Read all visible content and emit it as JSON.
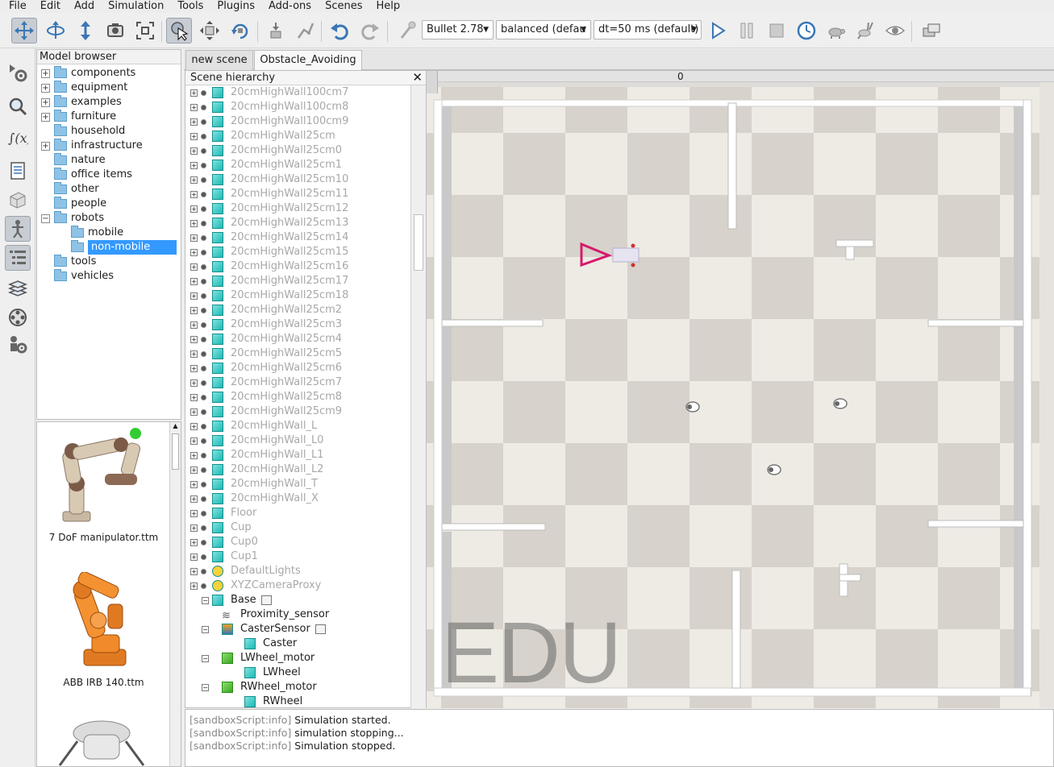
{
  "menu": [
    "File",
    "Edit",
    "Add",
    "Simulation",
    "Tools",
    "Plugins",
    "Add-ons",
    "Scenes",
    "Help"
  ],
  "toolbar": {
    "engine": "Bullet 2.78",
    "mode": "balanced (defau",
    "dt": "dt=50 ms (default)",
    "icons": [
      "camera-pan-icon",
      "camera-rotate-icon",
      "camera-shift-icon",
      "camera-angle-icon",
      "fit-to-view-icon",
      "object-select-icon",
      "object-shift-icon",
      "object-rotate-icon",
      "assemble-icon",
      "transfer-dna-icon",
      "undo-icon",
      "redo-icon",
      "dynamics-toggle-icon",
      "play-icon",
      "pause-icon",
      "stop-icon",
      "realtime-icon",
      "slower-icon",
      "faster-icon",
      "visualization-icon",
      "scene-layers-icon"
    ]
  },
  "model_browser": {
    "title": "Model browser",
    "items": [
      {
        "label": "components",
        "expander": "+"
      },
      {
        "label": "equipment",
        "expander": "+"
      },
      {
        "label": "examples",
        "expander": "+"
      },
      {
        "label": "furniture",
        "expander": "+"
      },
      {
        "label": "household",
        "expander": ""
      },
      {
        "label": "infrastructure",
        "expander": "+"
      },
      {
        "label": "nature",
        "expander": ""
      },
      {
        "label": "office items",
        "expander": ""
      },
      {
        "label": "other",
        "expander": ""
      },
      {
        "label": "people",
        "expander": ""
      },
      {
        "label": "robots",
        "expander": "−"
      },
      {
        "label": "mobile",
        "expander": "",
        "child": true
      },
      {
        "label": "non-mobile",
        "expander": "",
        "child": true,
        "selected": true
      },
      {
        "label": "tools",
        "expander": ""
      },
      {
        "label": "vehicles",
        "expander": ""
      }
    ]
  },
  "thumbnails": [
    {
      "label": "7 DoF manipulator.ttm"
    },
    {
      "label": "ABB IRB 140.ttm"
    }
  ],
  "tabs": [
    "new scene",
    "Obstacle_Avoiding"
  ],
  "hierarchy": {
    "title": "Scene hierarchy",
    "close": "✕",
    "items": [
      {
        "label": "20cmHighWall100cm7",
        "dim": true
      },
      {
        "label": "20cmHighWall100cm8",
        "dim": true
      },
      {
        "label": "20cmHighWall100cm9",
        "dim": true
      },
      {
        "label": "20cmHighWall25cm",
        "dim": true
      },
      {
        "label": "20cmHighWall25cm0",
        "dim": true
      },
      {
        "label": "20cmHighWall25cm1",
        "dim": true
      },
      {
        "label": "20cmHighWall25cm10",
        "dim": true
      },
      {
        "label": "20cmHighWall25cm11",
        "dim": true
      },
      {
        "label": "20cmHighWall25cm12",
        "dim": true
      },
      {
        "label": "20cmHighWall25cm13",
        "dim": true
      },
      {
        "label": "20cmHighWall25cm14",
        "dim": true
      },
      {
        "label": "20cmHighWall25cm15",
        "dim": true
      },
      {
        "label": "20cmHighWall25cm16",
        "dim": true
      },
      {
        "label": "20cmHighWall25cm17",
        "dim": true
      },
      {
        "label": "20cmHighWall25cm18",
        "dim": true
      },
      {
        "label": "20cmHighWall25cm2",
        "dim": true
      },
      {
        "label": "20cmHighWall25cm3",
        "dim": true
      },
      {
        "label": "20cmHighWall25cm4",
        "dim": true
      },
      {
        "label": "20cmHighWall25cm5",
        "dim": true
      },
      {
        "label": "20cmHighWall25cm6",
        "dim": true
      },
      {
        "label": "20cmHighWall25cm7",
        "dim": true
      },
      {
        "label": "20cmHighWall25cm8",
        "dim": true
      },
      {
        "label": "20cmHighWall25cm9",
        "dim": true
      },
      {
        "label": "20cmHighWall_L",
        "dim": true
      },
      {
        "label": "20cmHighWall_L0",
        "dim": true
      },
      {
        "label": "20cmHighWall_L1",
        "dim": true
      },
      {
        "label": "20cmHighWall_L2",
        "dim": true
      },
      {
        "label": "20cmHighWall_T",
        "dim": true
      },
      {
        "label": "20cmHighWall_X",
        "dim": true
      },
      {
        "label": "Floor",
        "dim": true
      },
      {
        "label": "Cup",
        "dim": true
      },
      {
        "label": "Cup0",
        "dim": true
      },
      {
        "label": "Cup1",
        "dim": true
      },
      {
        "label": "DefaultLights",
        "dim": true
      },
      {
        "label": "XYZCameraProxy",
        "dim": true
      },
      {
        "label": "Base",
        "dim": false,
        "level": 0
      },
      {
        "label": "Proximity_sensor",
        "dim": false,
        "level": 1
      },
      {
        "label": "CasterSensor",
        "dim": false,
        "level": 1
      },
      {
        "label": "Caster",
        "dim": false,
        "level": 2
      },
      {
        "label": "LWheel_motor",
        "dim": false,
        "level": 1
      },
      {
        "label": "LWheel",
        "dim": false,
        "level": 2
      },
      {
        "label": "RWheel_motor",
        "dim": false,
        "level": 1
      },
      {
        "label": "RWheel",
        "dim": false,
        "level": 2
      }
    ]
  },
  "viewport": {
    "ruler_value": "0",
    "watermark": "EDU"
  },
  "console": {
    "lines": [
      {
        "src": "[sandboxScript:info]",
        "msg": " Simulation started."
      },
      {
        "src": "[sandboxScript:info]",
        "msg": " simulation stopping..."
      },
      {
        "src": "[sandboxScript:info]",
        "msg": " Simulation stopped."
      }
    ]
  }
}
